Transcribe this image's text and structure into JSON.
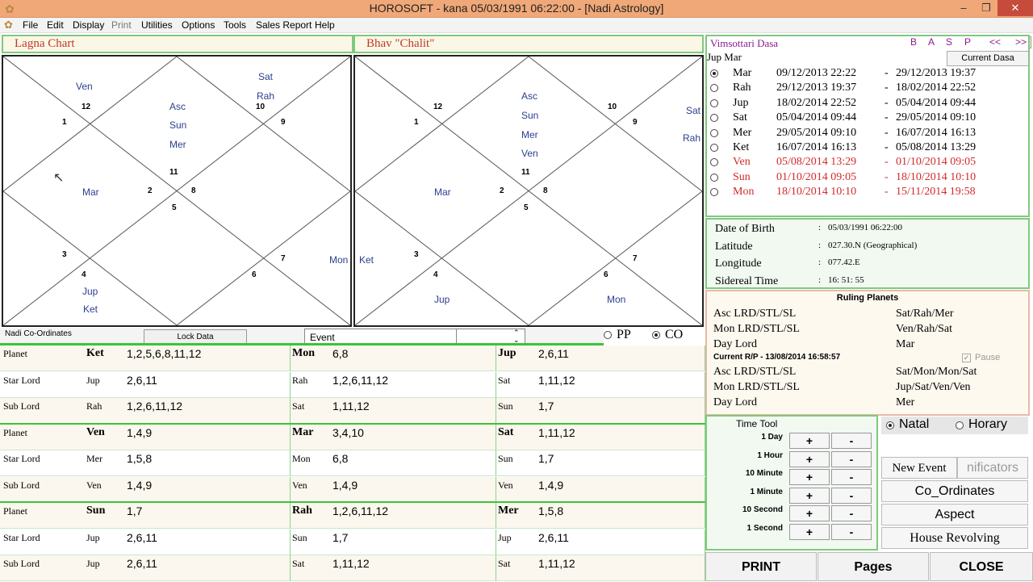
{
  "window": {
    "title": "HOROSOFT -  kana 05/03/1991 06:22:00 - [Nadi Astrology]"
  },
  "menu": [
    "File",
    "Edit",
    "Display",
    "Print",
    "Utilities",
    "Options",
    "Tools",
    "Sales Report",
    "Help"
  ],
  "charts": {
    "lagna_title": "Lagna Chart",
    "bhav_title": "Bhav \"Chalit\"",
    "lagna_nums": [
      "12",
      "1",
      "10",
      "9",
      "11",
      "2",
      "8",
      "5",
      "3",
      "4",
      "7",
      "6"
    ],
    "lagna_planets": {
      "ven": "Ven",
      "asc": "Asc",
      "sun": "Sun",
      "mer": "Mer",
      "sat": "Sat",
      "rah": "Rah",
      "mar": "Mar",
      "mon": "Mon",
      "jup": "Jup",
      "ket": "Ket"
    },
    "bhav_nums": [
      "12",
      "1",
      "10",
      "9",
      "11",
      "2",
      "8",
      "5",
      "3",
      "4",
      "7",
      "6"
    ],
    "bhav_planets": {
      "asc": "Asc",
      "sun": "Sun",
      "mer": "Mer",
      "ven": "Ven",
      "sat": "Sat",
      "rah": "Rah",
      "mar": "Mar",
      "ket": "Ket",
      "jup": "Jup",
      "mon": "Mon"
    }
  },
  "nadi": {
    "label": "Nadi Co-Ordinates",
    "lock_button": "Lock Data",
    "event_label": "Event",
    "pp": "PP",
    "co": "CO"
  },
  "table": [
    [
      [
        "Planet",
        "Ket",
        "1,2,5,6,8,11,12"
      ],
      [
        "",
        "Mon",
        "6,8"
      ],
      [
        "",
        "Jup",
        "2,6,11"
      ]
    ],
    [
      [
        "Star Lord",
        "Jup",
        "2,6,11"
      ],
      [
        "",
        "Rah",
        "1,2,6,11,12"
      ],
      [
        "",
        "Sat",
        "1,11,12"
      ]
    ],
    [
      [
        "Sub Lord",
        "Rah",
        "1,2,6,11,12"
      ],
      [
        "",
        "Sat",
        "1,11,12"
      ],
      [
        "",
        "Sun",
        "1,7"
      ]
    ],
    [
      [
        "Planet",
        "Ven",
        "1,4,9"
      ],
      [
        "",
        "Mar",
        "3,4,10"
      ],
      [
        "",
        "Sat",
        "1,11,12"
      ]
    ],
    [
      [
        "Star Lord",
        "Mer",
        "1,5,8"
      ],
      [
        "",
        "Mon",
        "6,8"
      ],
      [
        "",
        "Sun",
        "1,7"
      ]
    ],
    [
      [
        "Sub Lord",
        "Ven",
        "1,4,9"
      ],
      [
        "",
        "Ven",
        "1,4,9"
      ],
      [
        "",
        "Ven",
        "1,4,9"
      ]
    ],
    [
      [
        "Planet",
        "Sun",
        "1,7"
      ],
      [
        "",
        "Rah",
        "1,2,6,11,12"
      ],
      [
        "",
        "Mer",
        "1,5,8"
      ]
    ],
    [
      [
        "Star Lord",
        "Jup",
        "2,6,11"
      ],
      [
        "",
        "Sun",
        "1,7"
      ],
      [
        "",
        "Jup",
        "2,6,11"
      ]
    ],
    [
      [
        "Sub Lord",
        "Jup",
        "2,6,11"
      ],
      [
        "",
        "Sat",
        "1,11,12"
      ],
      [
        "",
        "Sat",
        "1,11,12"
      ]
    ]
  ],
  "dasa": {
    "title": "Vimsottari Dasa",
    "nav": [
      "B",
      "A",
      "S",
      "P",
      "<<",
      ">>"
    ],
    "current_btn": "Current Dasa",
    "header": "Jup Mar",
    "rows": [
      {
        "p": "Mar",
        "from": "09/12/2013 22:22",
        "to": "29/12/2013 19:37",
        "sel": true,
        "red": false
      },
      {
        "p": "Rah",
        "from": "29/12/2013 19:37",
        "to": "18/02/2014 22:52",
        "sel": false,
        "red": false
      },
      {
        "p": "Jup",
        "from": "18/02/2014 22:52",
        "to": "05/04/2014 09:44",
        "sel": false,
        "red": false
      },
      {
        "p": "Sat",
        "from": "05/04/2014 09:44",
        "to": "29/05/2014 09:10",
        "sel": false,
        "red": false
      },
      {
        "p": "Mer",
        "from": "29/05/2014 09:10",
        "to": "16/07/2014 16:13",
        "sel": false,
        "red": false
      },
      {
        "p": "Ket",
        "from": "16/07/2014 16:13",
        "to": "05/08/2014 13:29",
        "sel": false,
        "red": false
      },
      {
        "p": "Ven",
        "from": "05/08/2014 13:29",
        "to": "01/10/2014 09:05",
        "sel": false,
        "red": true
      },
      {
        "p": "Sun",
        "from": "01/10/2014 09:05",
        "to": "18/10/2014 10:10",
        "sel": false,
        "red": true
      },
      {
        "p": "Mon",
        "from": "18/10/2014 10:10",
        "to": "15/11/2014 19:58",
        "sel": false,
        "red": true
      }
    ]
  },
  "birth": [
    {
      "k": "Date of Birth",
      "v": "05/03/1991 06:22:00"
    },
    {
      "k": "Latitude",
      "v": "027.30.N (Geographical)"
    },
    {
      "k": "Longitude",
      "v": "077.42.E"
    },
    {
      "k": "Sidereal Time",
      "v": " 16: 51: 55"
    }
  ],
  "ruling": {
    "title": "Ruling Planets",
    "rows1": [
      {
        "k": "Asc LRD/STL/SL",
        "v": "Sat/Rah/Mer"
      },
      {
        "k": "Mon LRD/STL/SL",
        "v": "Ven/Rah/Sat"
      },
      {
        "k": "Day Lord",
        "v": "Mar"
      }
    ],
    "current": "Current R/P - 13/08/2014 16:58:57",
    "pause": "Pause",
    "rows2": [
      {
        "k": "Asc LRD/STL/SL",
        "v": "Sat/Mon/Mon/Sat"
      },
      {
        "k": "Mon LRD/STL/SL",
        "v": "Jup/Sat/Ven/Ven"
      },
      {
        "k": "Day Lord",
        "v": "Mer"
      }
    ]
  },
  "timetool": {
    "title": "Time Tool",
    "rows": [
      "1 Day",
      "1 Hour",
      "10 Minute",
      "1 Minute",
      "10 Second",
      "1 Second"
    ],
    "plus": "+",
    "minus": "-"
  },
  "side": {
    "natal": "Natal",
    "horary": "Horary",
    "new_event": "New Event",
    "significators": "nificators",
    "coord": "Co_Ordinates",
    "aspect": "Aspect",
    "house": "House Revolving"
  },
  "bottom": {
    "print": "PRINT",
    "pages": "Pages",
    "close": "CLOSE"
  }
}
